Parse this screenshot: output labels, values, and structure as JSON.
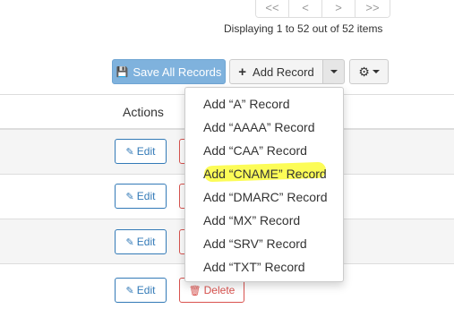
{
  "pagination": {
    "first": "<<",
    "prev": "<",
    "next": ">",
    "last": ">>"
  },
  "display_info": "Displaying 1 to 52 out of 52 items",
  "toolbar": {
    "save_label": "Save All Records",
    "add_label": "Add Record"
  },
  "table": {
    "actions_header": "Actions",
    "edit_label": "Edit",
    "delete_label": "Delete"
  },
  "dropdown": {
    "items": [
      "Add “A” Record",
      "Add “AAAA” Record",
      "Add “CAA” Record",
      "Add “CNAME” Record",
      "Add “DMARC” Record",
      "Add “MX” Record",
      "Add “SRV” Record",
      "Add “TXT” Record"
    ]
  },
  "colors": {
    "primary": "#7fb2dd",
    "link": "#337ab7",
    "danger": "#d9534f",
    "highlight": "#fbfb3a"
  }
}
